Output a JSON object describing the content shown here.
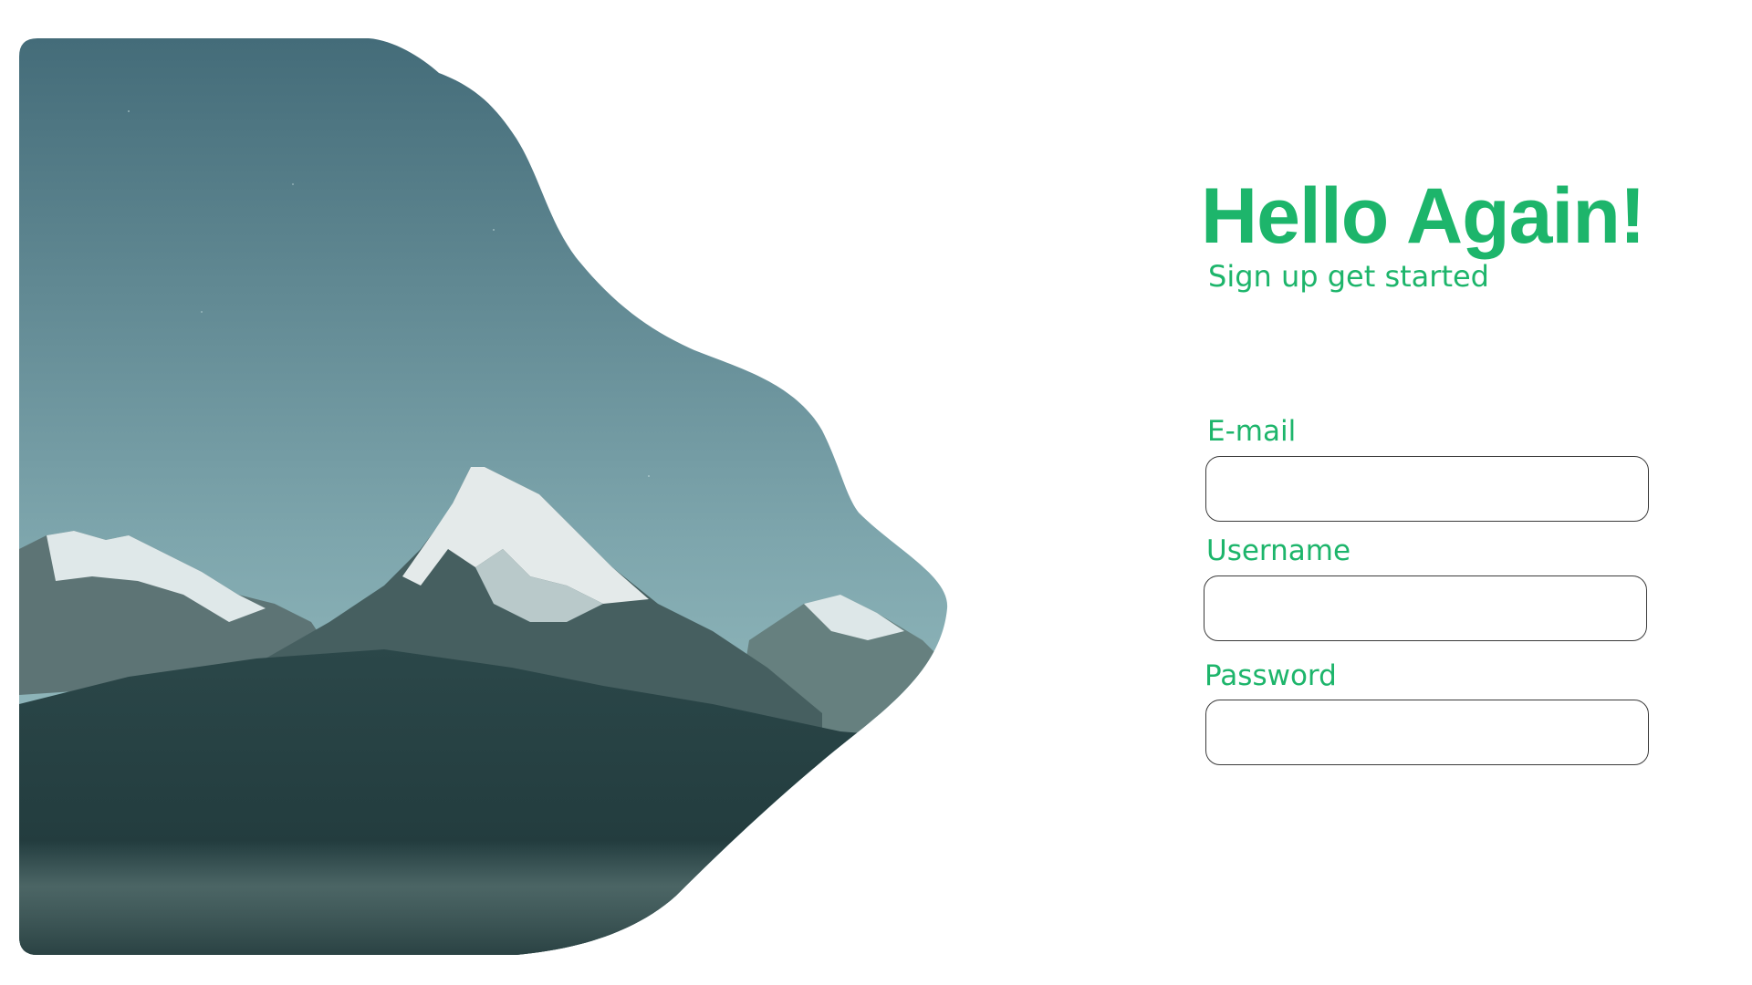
{
  "hero": {
    "image": "mountain-landscape",
    "colors": {
      "sky_top": "#466f7c",
      "sky_bottom": "#a3c9cb",
      "snow": "#e6ecec",
      "rock": "#3f5a5c",
      "foreground": "#223e40",
      "mist": "#4d6869"
    }
  },
  "form": {
    "title": "Hello Again!",
    "subtitle": "Sign up get started",
    "fields": [
      {
        "label": "E-mail",
        "value": ""
      },
      {
        "label": "Username",
        "value": ""
      },
      {
        "label": "Password",
        "value": ""
      }
    ]
  },
  "theme": {
    "accent": "#1db56b",
    "input_border": "#3a3a3a",
    "background": "#ffffff"
  }
}
